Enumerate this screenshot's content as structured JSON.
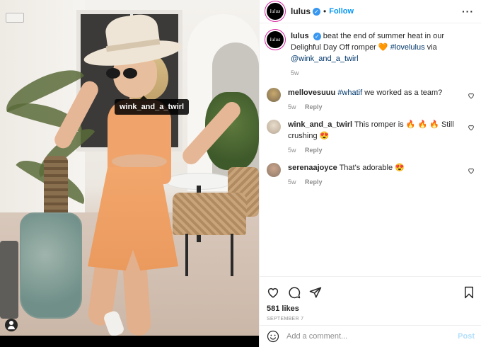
{
  "photo": {
    "tag_label": "wink_and_a_twirl"
  },
  "header": {
    "handle": "lulus",
    "verified_mark": "✓",
    "separator": "•",
    "follow_label": "Follow",
    "more_label": "···",
    "avatar_text": "lulus"
  },
  "caption": {
    "username": "lulus",
    "text_before": "beat the end of summer heat in our Delighful Day Off romper",
    "emoji": "🧡",
    "hashtag": "#lovelulus",
    "via": "via",
    "mention": "@wink_and_a_twirl",
    "time": "5w"
  },
  "comments": [
    {
      "username": "mellovesuuu",
      "hashtag": "#whatif",
      "text": "we worked as a team?",
      "time": "5w",
      "reply": "Reply",
      "avatar_color": "#7a6a4f"
    },
    {
      "username": "wink_and_a_twirl",
      "text": "This romper is",
      "emojis": "🔥 🔥 🔥",
      "text_after": "Still crushing",
      "emoji_end": "😍",
      "time": "5w",
      "reply": "Reply",
      "avatar_color": "#b9a995"
    },
    {
      "username": "serenaajoyce",
      "text": "That's adorable",
      "emoji_end": "😍",
      "time": "5w",
      "reply": "Reply",
      "avatar_color": "#8d7866"
    }
  ],
  "actions": {
    "likes": "581 likes",
    "date": "SEPTEMBER 7"
  },
  "comment_box": {
    "placeholder": "Add a comment...",
    "post_label": "Post"
  },
  "colors": {
    "accent_blue": "#0095f6",
    "link_blue": "#00376b",
    "muted": "#8e8e8e",
    "romper": "#f0a36a"
  }
}
